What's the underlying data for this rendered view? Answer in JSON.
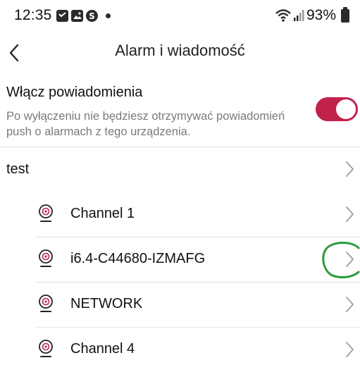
{
  "status_bar": {
    "time": "12:35",
    "battery": "93%",
    "icons": [
      "notification-icon",
      "gallery-icon",
      "app-s-icon",
      "dot-icon",
      "wifi-icon",
      "signal-icon",
      "battery-icon"
    ]
  },
  "header": {
    "title": "Alarm i wiadomość",
    "back_icon": "back-arrow-icon"
  },
  "notifications": {
    "title": "Włącz powiadomienia",
    "description": "Po wyłączeniu nie będziesz otrzymywać powiadomień push o alarmach z tego urządzenia.",
    "enabled": true
  },
  "device": {
    "name": "test"
  },
  "channels": [
    {
      "name": "Channel 1"
    },
    {
      "name": "i6.4-C44680-IZMAFG"
    },
    {
      "name": "NETWORK"
    },
    {
      "name": "Channel 4"
    }
  ],
  "colors": {
    "accent": "#c0224a",
    "annotation": "#2a9a3c",
    "secondary_text": "#7a7a7a",
    "chevron": "#9e9e9e"
  }
}
